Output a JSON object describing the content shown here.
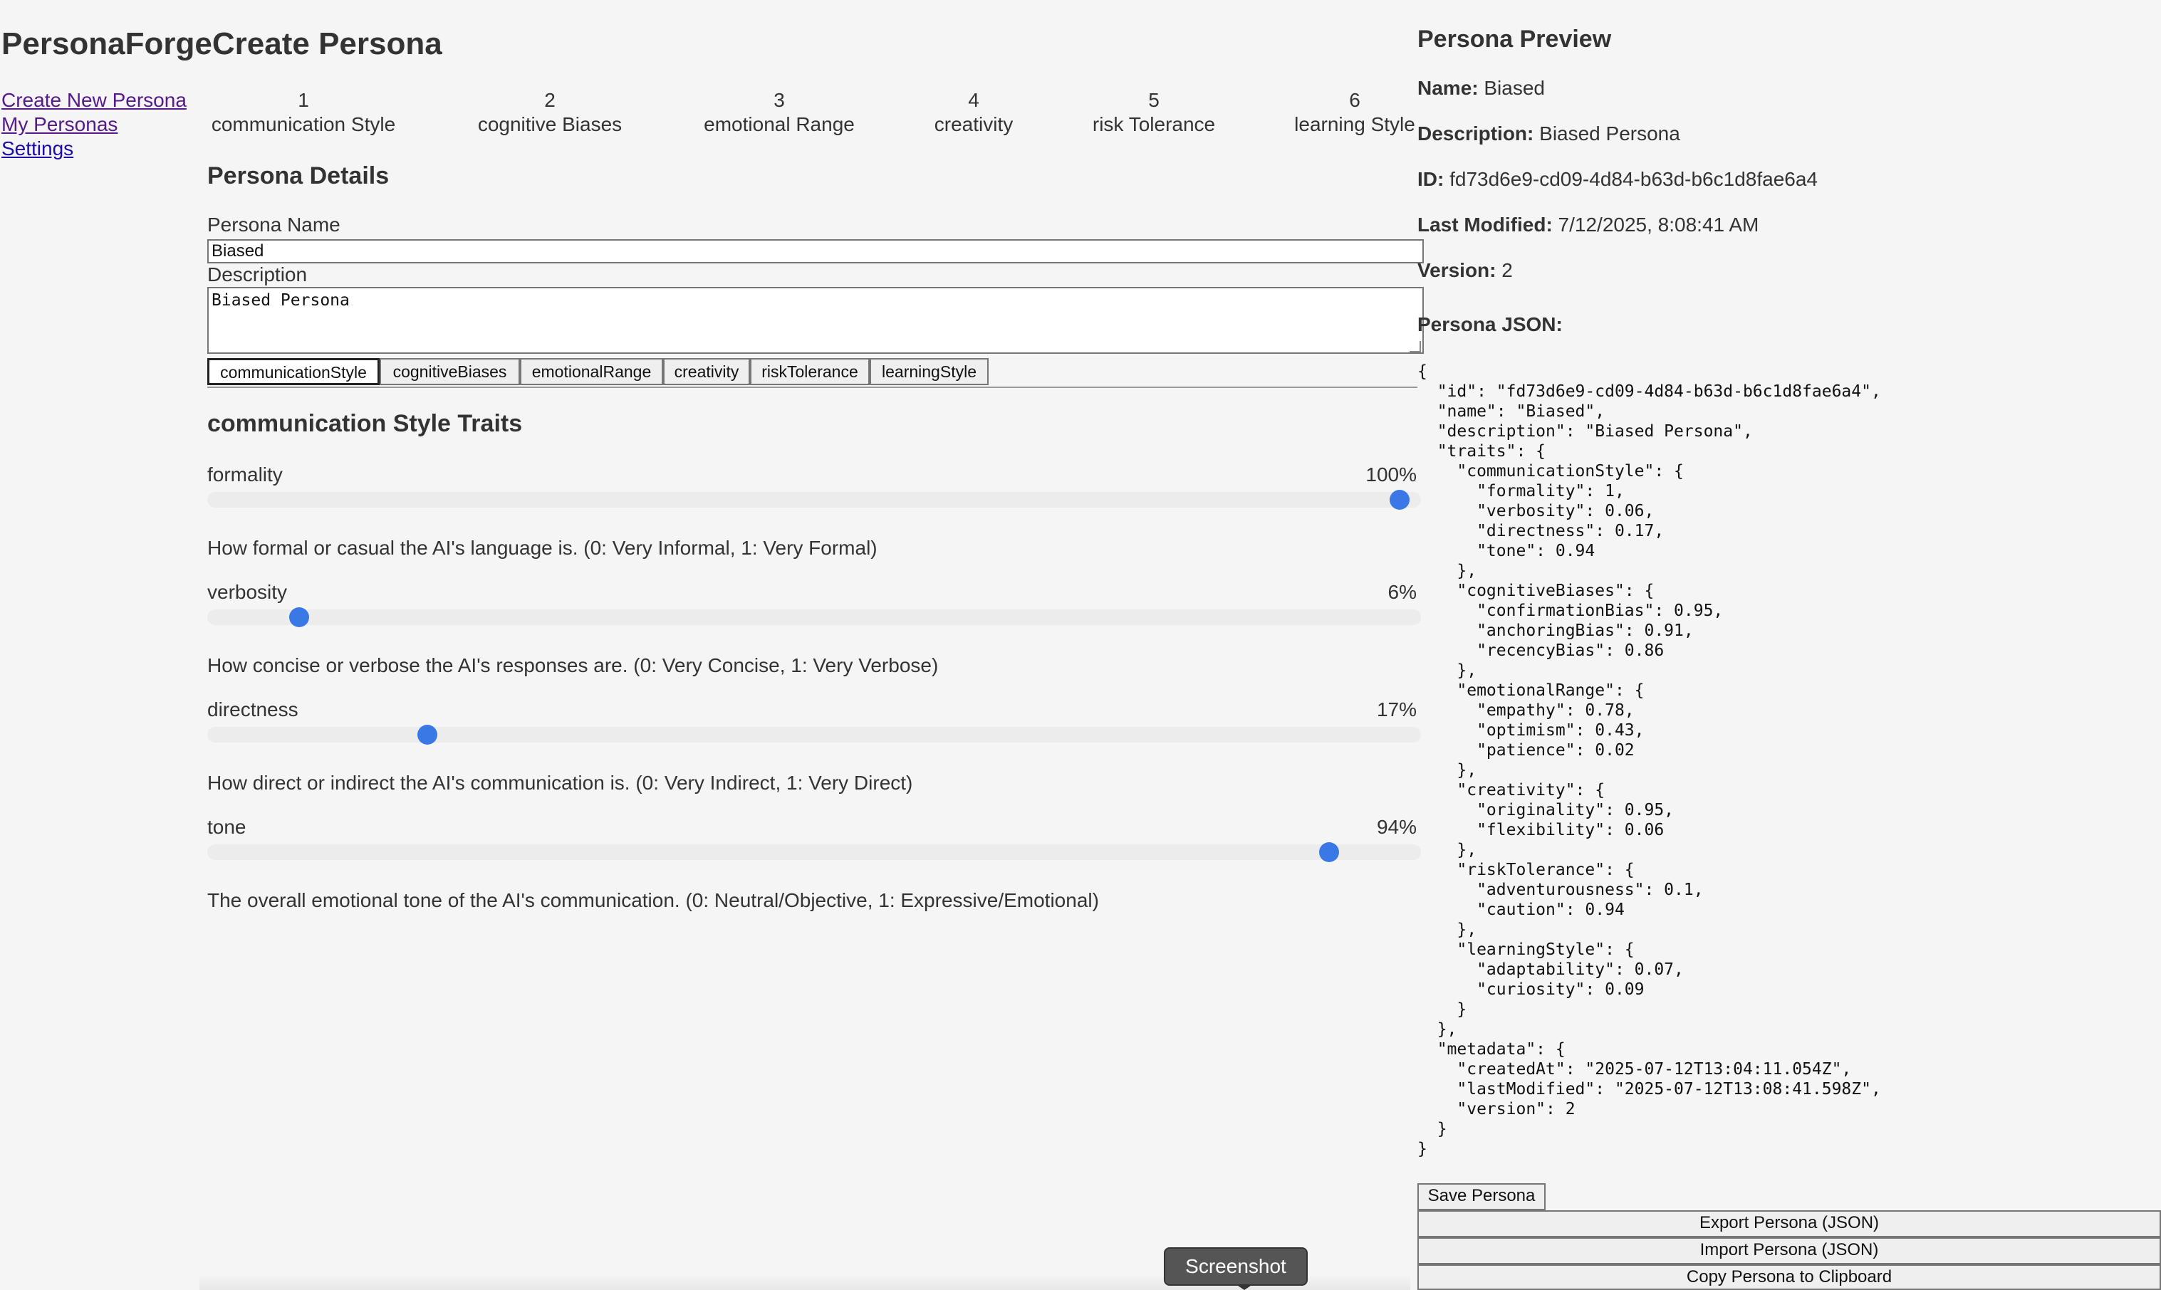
{
  "app": {
    "brand": "PersonaForge",
    "page_title": "Create Persona"
  },
  "sidebar": {
    "items": [
      {
        "label": "Create New Persona"
      },
      {
        "label": "My Personas"
      },
      {
        "label": "Settings"
      }
    ]
  },
  "stepper": {
    "steps": [
      {
        "number": "1",
        "label": "communication Style"
      },
      {
        "number": "2",
        "label": "cognitive Biases"
      },
      {
        "number": "3",
        "label": "emotional Range"
      },
      {
        "number": "4",
        "label": "creativity"
      },
      {
        "number": "5",
        "label": "risk Tolerance"
      },
      {
        "number": "6",
        "label": "learning Style"
      }
    ]
  },
  "details": {
    "heading": "Persona Details",
    "name_label": "Persona Name",
    "name_value": "Biased",
    "description_label": "Description",
    "description_value": "Biased Persona"
  },
  "tabs": [
    {
      "label": "communicationStyle",
      "active": true
    },
    {
      "label": "cognitiveBiases",
      "active": false
    },
    {
      "label": "emotionalRange",
      "active": false
    },
    {
      "label": "creativity",
      "active": false
    },
    {
      "label": "riskTolerance",
      "active": false
    },
    {
      "label": "learningStyle",
      "active": false
    }
  ],
  "traits_section": {
    "heading": "communication Style Traits",
    "traits": [
      {
        "name": "formality",
        "value": 1,
        "value_text": "100%",
        "description": "How formal or casual the AI's language is. (0: Very Informal, 1: Very Formal)"
      },
      {
        "name": "verbosity",
        "value": 0.06,
        "value_text": "6%",
        "description": "How concise or verbose the AI's responses are. (0: Very Concise, 1: Very Verbose)"
      },
      {
        "name": "directness",
        "value": 0.17,
        "value_text": "17%",
        "description": "How direct or indirect the AI's communication is. (0: Very Indirect, 1: Very Direct)"
      },
      {
        "name": "tone",
        "value": 0.94,
        "value_text": "94%",
        "description": "The overall emotional tone of the AI's communication. (0: Neutral/Objective, 1: Expressive/Emotional)"
      }
    ]
  },
  "preview": {
    "title": "Persona Preview",
    "name_label": "Name:",
    "name_value": "Biased",
    "description_label": "Description:",
    "description_value": "Biased Persona",
    "id_label": "ID:",
    "id_value": "fd73d6e9-cd09-4d84-b63d-b6c1d8fae6a4",
    "modified_label": "Last Modified:",
    "modified_value": "7/12/2025, 8:08:41 AM",
    "version_label": "Version:",
    "version_value": "2",
    "json_heading": "Persona JSON:",
    "json_text": "{\n  \"id\": \"fd73d6e9-cd09-4d84-b63d-b6c1d8fae6a4\",\n  \"name\": \"Biased\",\n  \"description\": \"Biased Persona\",\n  \"traits\": {\n    \"communicationStyle\": {\n      \"formality\": 1,\n      \"verbosity\": 0.06,\n      \"directness\": 0.17,\n      \"tone\": 0.94\n    },\n    \"cognitiveBiases\": {\n      \"confirmationBias\": 0.95,\n      \"anchoringBias\": 0.91,\n      \"recencyBias\": 0.86\n    },\n    \"emotionalRange\": {\n      \"empathy\": 0.78,\n      \"optimism\": 0.43,\n      \"patience\": 0.02\n    },\n    \"creativity\": {\n      \"originality\": 0.95,\n      \"flexibility\": 0.06\n    },\n    \"riskTolerance\": {\n      \"adventurousness\": 0.1,\n      \"caution\": 0.94\n    },\n    \"learningStyle\": {\n      \"adaptability\": 0.07,\n      \"curiosity\": 0.09\n    }\n  },\n  \"metadata\": {\n    \"createdAt\": \"2025-07-12T13:04:11.054Z\",\n    \"lastModified\": \"2025-07-12T13:08:41.598Z\",\n    \"version\": 2\n  }\n}"
  },
  "actions": {
    "save": "Save Persona",
    "export": "Export Persona (JSON)",
    "import": "Import Persona (JSON)",
    "copy": "Copy Persona to Clipboard"
  },
  "overlay": {
    "screenshot_label": "Screenshot"
  },
  "colors": {
    "accent": "#3a78e6",
    "link": "#1a0dab",
    "link_visited": "#551a8b"
  }
}
